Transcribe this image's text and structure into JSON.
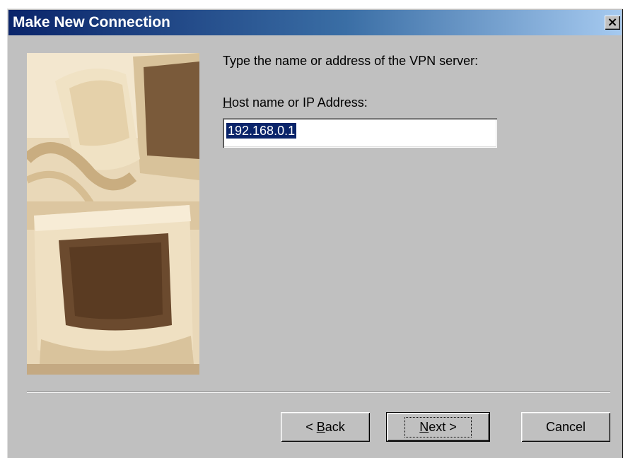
{
  "window": {
    "title": "Make New Connection",
    "close_glyph": "×"
  },
  "wizard": {
    "prompt": "Type the name or address of the VPN server:",
    "field_label_accel": "H",
    "field_label_rest": "ost name or IP Address:",
    "host_value": "192.168.0.1",
    "illustration": "monitors-and-phone-illustration"
  },
  "buttons": {
    "back_prefix": "< ",
    "back_accel": "B",
    "back_rest": "ack",
    "next_accel": "N",
    "next_rest": "ext >",
    "cancel": "Cancel"
  },
  "colors": {
    "title_gradient_start": "#0a246a",
    "title_gradient_end": "#a6caf0",
    "dialog_face": "#c0c0c0",
    "selection": "#0a246a"
  }
}
